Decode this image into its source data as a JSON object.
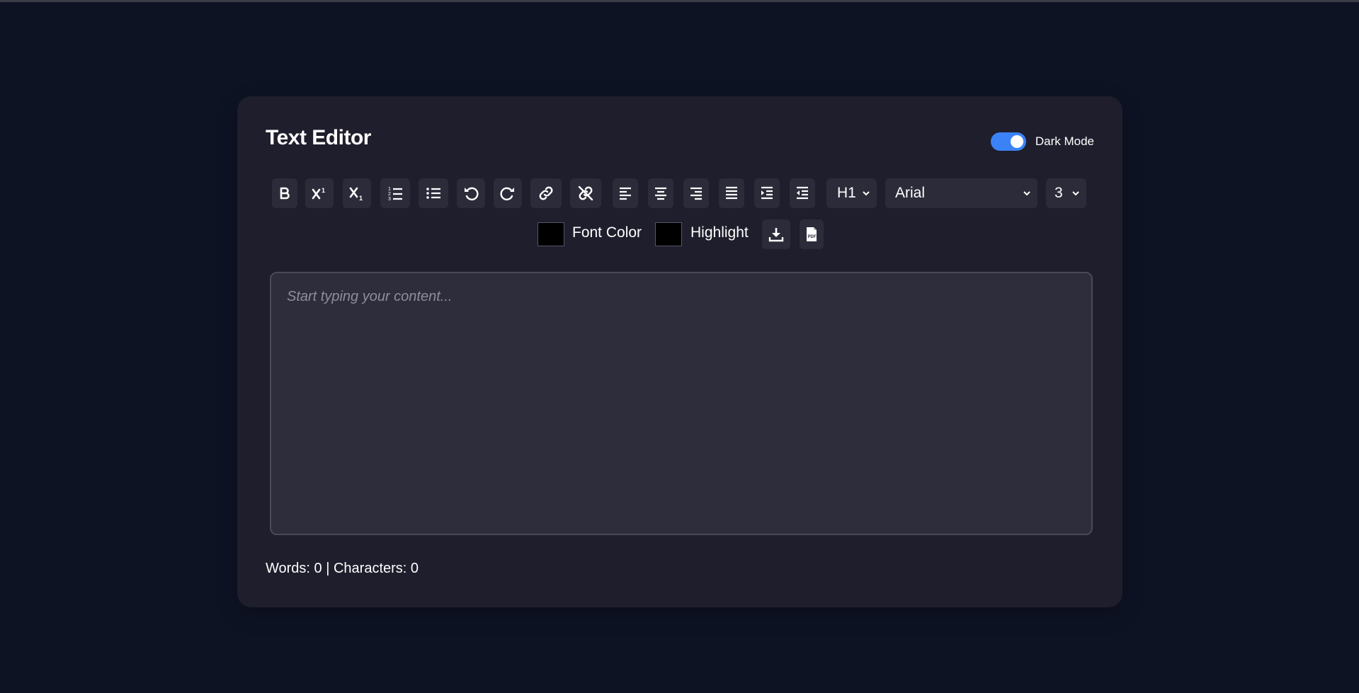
{
  "app": {
    "title": "Text Editor"
  },
  "dark_mode": {
    "label": "Dark Mode",
    "enabled": true,
    "accent": "#3b82f6"
  },
  "toolbar": {
    "buttons": [
      {
        "name": "bold",
        "icon": "bold-icon"
      },
      {
        "name": "superscript",
        "icon": "superscript-icon"
      },
      {
        "name": "subscript",
        "icon": "subscript-icon"
      },
      {
        "name": "ordered-list",
        "icon": "ordered-list-icon"
      },
      {
        "name": "unordered-list",
        "icon": "unordered-list-icon"
      },
      {
        "name": "undo",
        "icon": "undo-icon"
      },
      {
        "name": "redo",
        "icon": "redo-icon"
      },
      {
        "name": "link",
        "icon": "link-icon"
      },
      {
        "name": "unlink",
        "icon": "unlink-icon"
      },
      {
        "name": "align-left",
        "icon": "align-left-icon"
      },
      {
        "name": "align-center",
        "icon": "align-center-icon"
      },
      {
        "name": "align-right",
        "icon": "align-right-icon"
      },
      {
        "name": "justify",
        "icon": "justify-icon"
      },
      {
        "name": "indent",
        "icon": "indent-icon"
      },
      {
        "name": "outdent",
        "icon": "outdent-icon"
      }
    ],
    "heading_select": "H1",
    "font_select": "Arial",
    "size_select": "3",
    "font_color_label": "Font Color",
    "font_color_value": "#000000",
    "highlight_label": "Highlight",
    "highlight_value": "#000000",
    "download_icon": "download-icon",
    "pdf_icon": "pdf-icon"
  },
  "editor": {
    "placeholder": "Start typing your content..."
  },
  "status": {
    "counts": "Words: 0 | Characters: 0"
  }
}
